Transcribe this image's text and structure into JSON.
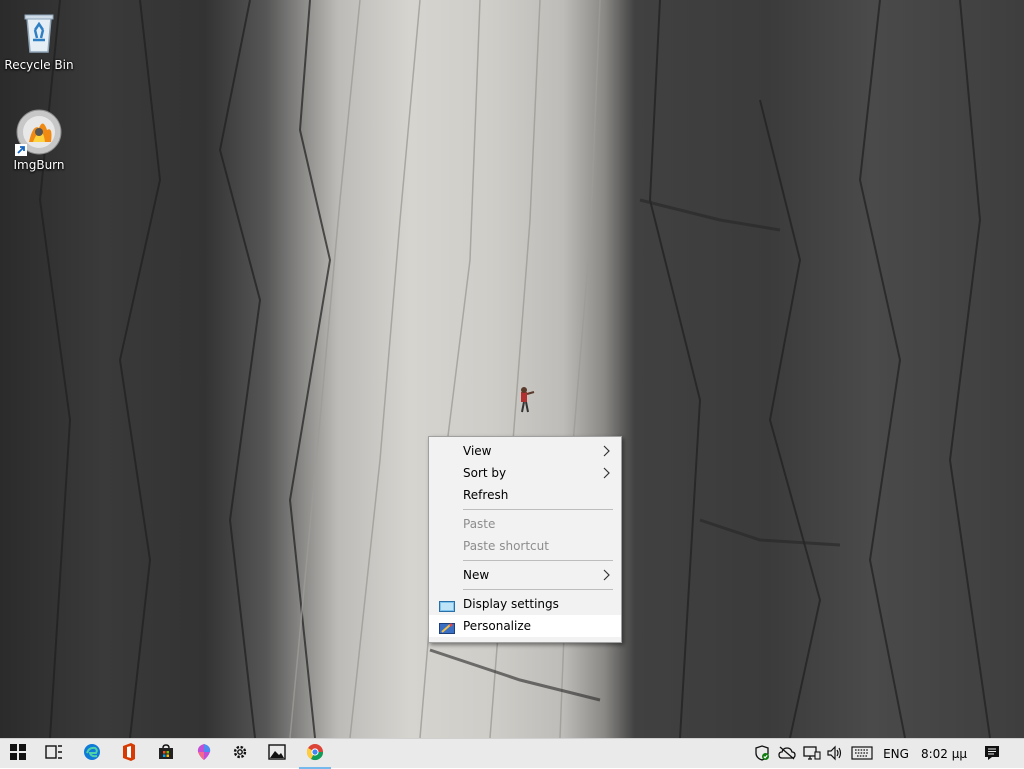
{
  "desktop": {
    "icons": [
      {
        "label": "Recycle Bin"
      },
      {
        "label": "ImgBurn"
      }
    ]
  },
  "context_menu": {
    "items": [
      {
        "label": "View",
        "submenu": true
      },
      {
        "label": "Sort by",
        "submenu": true
      },
      {
        "label": "Refresh"
      },
      {
        "label": "Paste",
        "disabled": true
      },
      {
        "label": "Paste shortcut",
        "disabled": true
      },
      {
        "label": "New",
        "submenu": true
      },
      {
        "label": "Display settings",
        "icon": "display-icon"
      },
      {
        "label": "Personalize",
        "icon": "personalize-icon"
      }
    ],
    "submenu_glyph": "›"
  },
  "taskbar": {
    "apps": [
      {
        "icon": "windows-start-icon"
      },
      {
        "icon": "task-view-icon"
      },
      {
        "icon": "edge-icon"
      },
      {
        "icon": "office-icon"
      },
      {
        "icon": "store-icon"
      },
      {
        "icon": "paint-3d-icon"
      },
      {
        "icon": "settings-gear-icon"
      },
      {
        "icon": "photos-icon"
      },
      {
        "icon": "chrome-icon",
        "active": true
      }
    ],
    "tray": {
      "language": "ENG",
      "clock": "8:02 μμ"
    }
  },
  "colors": {
    "taskbar_bg": "#eaeaea",
    "menu_bg": "#f2f2f2",
    "menu_hover": "#ffffff",
    "active_indicator": "#76b9ed",
    "office_orange": "#d83b01",
    "edge_blue": "#0f7ad8"
  }
}
